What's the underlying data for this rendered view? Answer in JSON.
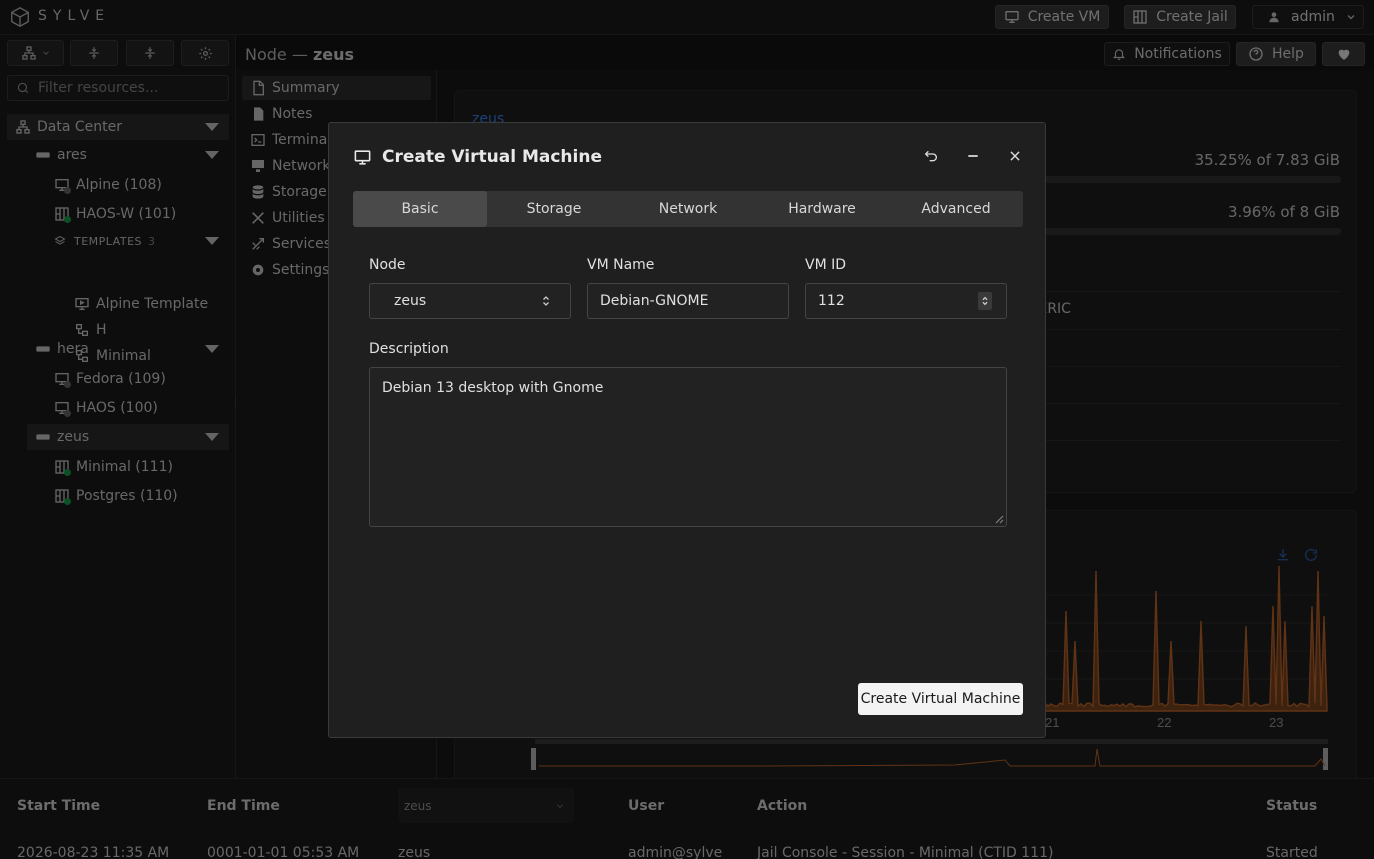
{
  "app": {
    "brand": "SYLVE"
  },
  "topbar": {
    "create_vm": "Create VM",
    "create_jail": "Create Jail",
    "user": "admin"
  },
  "sidebar": {
    "filter_placeholder": "Filter resources...",
    "datacenter": "Data Center",
    "ares": {
      "label": "ares",
      "items": [
        "Alpine (108)",
        "HAOS-W (101)"
      ],
      "templates_label": "TEMPLATES",
      "templates_count": "3",
      "templates": [
        "Alpine Template",
        "H",
        "Minimal"
      ]
    },
    "hera": {
      "label": "hera",
      "items": [
        "Fedora (109)",
        "HAOS (100)"
      ]
    },
    "zeus": {
      "label": "zeus",
      "items": [
        "Minimal (111)",
        "Postgres (110)"
      ]
    }
  },
  "page": {
    "title_prefix": "Node —",
    "title_node": "zeus"
  },
  "nav": [
    "Summary",
    "Notes",
    "Terminal",
    "Network",
    "Storage",
    "Utilities",
    "Services",
    "Settings"
  ],
  "header_buttons": {
    "notifications": "Notifications",
    "help": "Help"
  },
  "summary": {
    "node_link": "zeus",
    "memory_text": "35.25% of 7.83 GiB",
    "memory_pct": 35.25,
    "swap_text": "3.96% of 8 GiB",
    "swap_pct": 3.96,
    "cpu_model_frag": "NERIC",
    "chart_ticks": [
      "21",
      "22",
      "23"
    ]
  },
  "bottom_table": {
    "headers": {
      "start": "Start Time",
      "end": "End Time",
      "user": "User",
      "action": "Action",
      "status": "Status"
    },
    "node_filter": "zeus",
    "row": {
      "start": "2026-08-23 11:35 AM",
      "end": "0001-01-01 05:53 AM",
      "node": "zeus",
      "user": "admin@sylve",
      "action": "Jail Console - Session - Minimal (CTID 111)",
      "status": "Started"
    }
  },
  "modal": {
    "title": "Create Virtual Machine",
    "tabs": [
      "Basic",
      "Storage",
      "Network",
      "Hardware",
      "Advanced"
    ],
    "node_label": "Node",
    "node_value": "zeus",
    "vmname_label": "VM Name",
    "vmname_value": "Debian-GNOME",
    "vmid_label": "VM ID",
    "vmid_value": "112",
    "description_label": "Description",
    "description_value": "Debian 13 desktop with Gnome",
    "submit": "Create Virtual Machine"
  },
  "colors": {
    "accent": "#2563eb",
    "chart": "#c2672a",
    "online": "#16a34a",
    "offline": "#6b6b6b"
  }
}
